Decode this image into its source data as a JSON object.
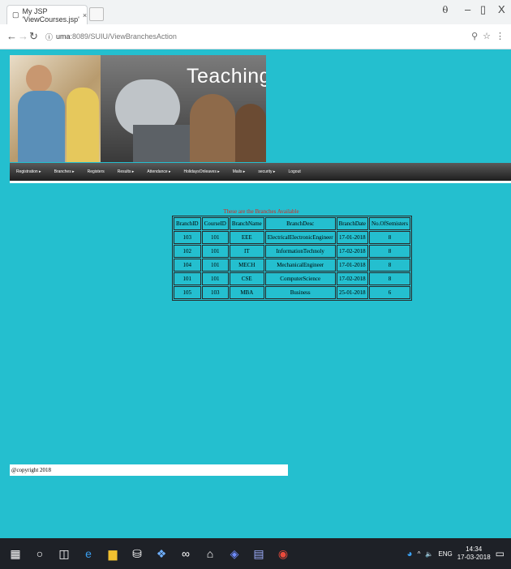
{
  "browser": {
    "tab_title": "My JSP 'ViewCourses.jsp'",
    "tab_close": "×",
    "url_host": "uma",
    "url_rest": ":8089/SUIU/ViewBranchesAction",
    "win_profile": "⍬",
    "win_minimize": "–",
    "win_maximize": "▯",
    "win_close": "X"
  },
  "banner": {
    "text": "Teaching"
  },
  "menu": {
    "items": [
      "Registration ▸",
      "Branches ▸",
      "Registers",
      "Results ▸",
      "Attendance ▸",
      "HolidaysOnleaves ▸",
      "Mails ▸",
      "security ▸",
      "Logout"
    ]
  },
  "table": {
    "caption": "These are the Branches Available",
    "headers": [
      "BranchID",
      "CourseID",
      "BranchName",
      "BranchDesc",
      "BranchDate",
      "No.OfSemisters"
    ],
    "rows": [
      [
        "103",
        "101",
        "EEE",
        "ElectricalElectronicEngineer",
        "17-01-2018",
        "8"
      ],
      [
        "102",
        "101",
        "IT",
        "InformationTechnoly",
        "17-02-2018",
        "8"
      ],
      [
        "104",
        "101",
        "MECH",
        "MechanicalEngineer",
        "17-01-2018",
        "8"
      ],
      [
        "101",
        "101",
        "CSE",
        "ComputerScience",
        "17-02-2018",
        "8"
      ],
      [
        "105",
        "103",
        "MBA",
        "Business",
        "25-01-2018",
        "6"
      ]
    ]
  },
  "footer": {
    "copyright": "@copyright 2018"
  },
  "taskbar": {
    "lang": "ENG",
    "time": "14:34",
    "date": "17-03-2018"
  },
  "colors": {
    "page_bg": "#24bfcf",
    "caption": "#e0241c",
    "menu_bg": "#2b2b2b"
  }
}
